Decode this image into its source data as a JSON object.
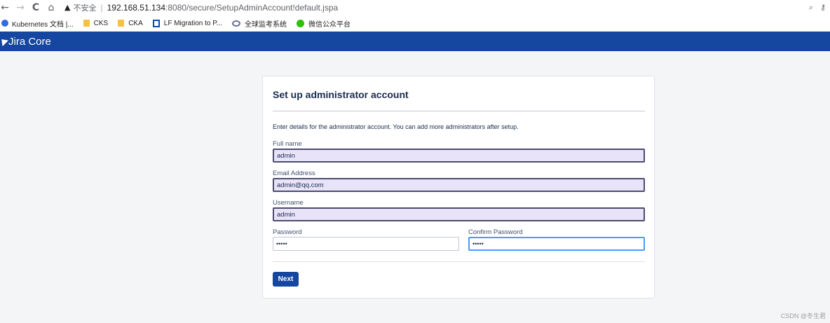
{
  "browser": {
    "back_icon": "←",
    "forward_icon": "→",
    "reload_icon": "C",
    "home_icon": "⌂",
    "security_label": "不安全",
    "url_host": "192.168.51.134",
    "url_rest": ":8080/secure/SetupAdminAccount!default.jspa",
    "zoom_icon": "⌕",
    "key_icon": "⚷"
  },
  "bookmarks": [
    {
      "label": "Kubernetes 文档 |..."
    },
    {
      "label": "CKS"
    },
    {
      "label": "CKA"
    },
    {
      "label": "LF Migration to P..."
    },
    {
      "label": "全球监考系统"
    },
    {
      "label": "微信公众平台"
    }
  ],
  "app": {
    "title": "Jira Core"
  },
  "form": {
    "title": "Set up administrator account",
    "intro": "Enter details for the administrator account. You can add more administrators after setup.",
    "full_name_label": "Full name",
    "full_name_value": "admin",
    "email_label": "Email Address",
    "email_value": "admin@qq.com",
    "username_label": "Username",
    "username_value": "admin",
    "password_label": "Password",
    "password_value": "•••••",
    "confirm_label": "Confirm Password",
    "confirm_value": "•••••",
    "next_label": "Next"
  },
  "watermark": "CSDN @冬生君"
}
